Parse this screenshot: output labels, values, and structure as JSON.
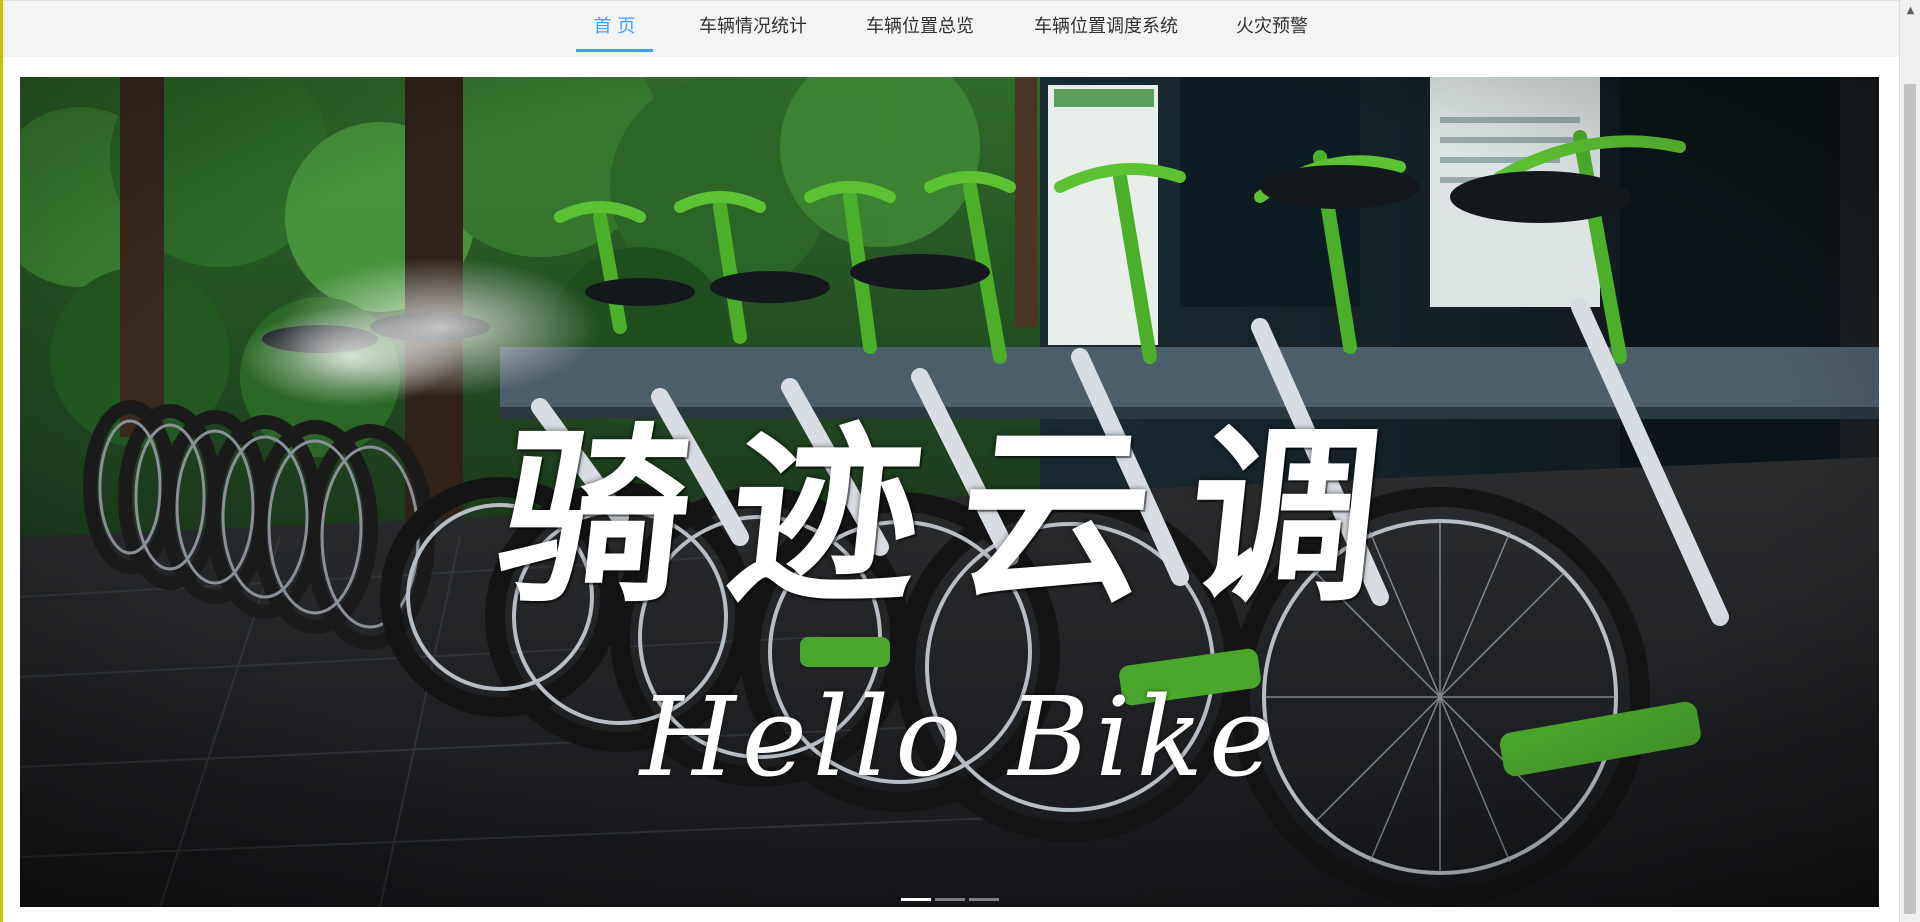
{
  "nav": {
    "items": [
      {
        "label": "首 页",
        "active": true
      },
      {
        "label": "车辆情况统计",
        "active": false
      },
      {
        "label": "车辆位置总览",
        "active": false
      },
      {
        "label": "车辆位置调度系统",
        "active": false
      },
      {
        "label": "火灾预警",
        "active": false
      }
    ]
  },
  "banner": {
    "title_cn": "骑迹云调",
    "title_en": "Hello Bike",
    "slide_count": 3,
    "active_slide": 1
  },
  "colors": {
    "accent": "#409eff",
    "nav_bg": "#f3f4f6",
    "bike_green": "#4caf2a"
  },
  "icons": {
    "scroll_up": "scroll-up-arrow-icon"
  }
}
